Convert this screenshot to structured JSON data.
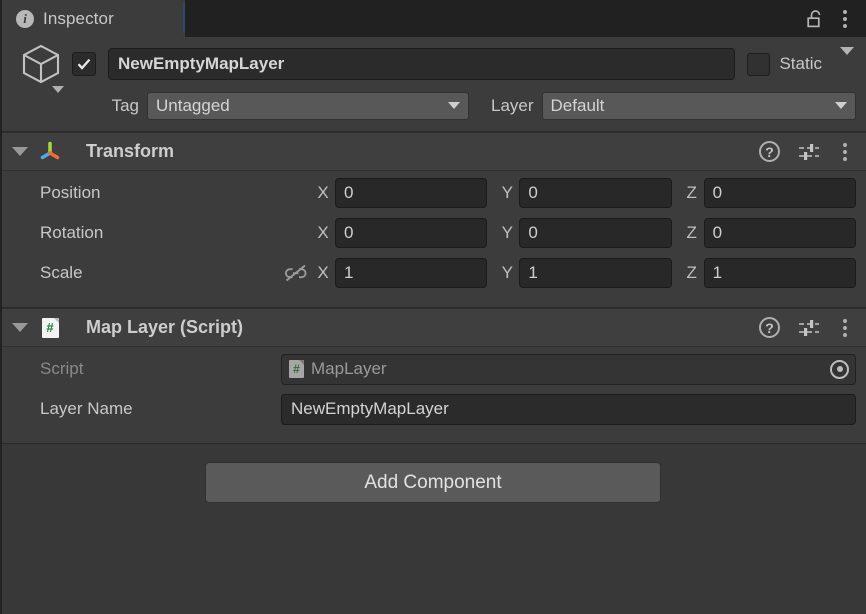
{
  "window": {
    "tab": {
      "label": "Inspector",
      "icon": "info-icon"
    },
    "lock_icon": "unlocked-padlock-icon",
    "menu_icon": "kebab-menu-icon"
  },
  "gameobject": {
    "icon": "cube-icon",
    "enabled": true,
    "name": "NewEmptyMapLayer",
    "static_label": "Static",
    "static_checked": false,
    "tag_label": "Tag",
    "tag_value": "Untagged",
    "layer_label": "Layer",
    "layer_value": "Default"
  },
  "components": [
    {
      "title": "Transform",
      "icon": "transform-axis-icon",
      "expanded": true,
      "help_icon": "help-icon",
      "preset_icon": "preset-sliders-icon",
      "menu_icon": "kebab-menu-icon",
      "rows": [
        {
          "label": "Position",
          "link_state": "none",
          "axes": [
            {
              "axis": "X",
              "value": "0"
            },
            {
              "axis": "Y",
              "value": "0"
            },
            {
              "axis": "Z",
              "value": "0"
            }
          ]
        },
        {
          "label": "Rotation",
          "link_state": "none",
          "axes": [
            {
              "axis": "X",
              "value": "0"
            },
            {
              "axis": "Y",
              "value": "0"
            },
            {
              "axis": "Z",
              "value": "0"
            }
          ]
        },
        {
          "label": "Scale",
          "link_state": "unlinked",
          "axes": [
            {
              "axis": "X",
              "value": "1"
            },
            {
              "axis": "Y",
              "value": "1"
            },
            {
              "axis": "Z",
              "value": "1"
            }
          ]
        }
      ]
    },
    {
      "title": "Map Layer (Script)",
      "icon": "csharp-script-icon",
      "expanded": true,
      "help_icon": "help-icon",
      "preset_icon": "preset-sliders-icon",
      "menu_icon": "kebab-menu-icon",
      "script_label": "Script",
      "script_value": "MapLayer",
      "script_picker_icon": "object-picker-icon",
      "layer_name_label": "Layer Name",
      "layer_name_value": "NewEmptyMapLayer"
    }
  ],
  "add_component": {
    "label": "Add Component"
  },
  "colors": {
    "panel_bg": "#383838",
    "header_bg": "#3c3c3c",
    "tabbar_bg": "#212121",
    "field_bg": "#282828",
    "dropdown_bg": "#585858",
    "button_bg": "#5a5a5a",
    "text": "#c8c8c8",
    "text_dim": "#8a8a8a",
    "axis_x": "#f07050",
    "axis_y": "#a0d030",
    "axis_z": "#50a0d0",
    "script_green": "#1d7a33"
  }
}
